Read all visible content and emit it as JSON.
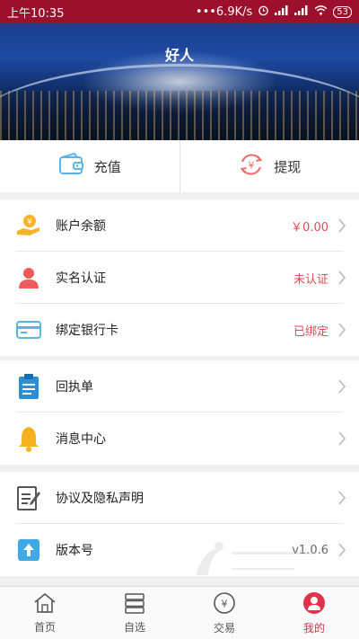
{
  "status_bar": {
    "time": "上午10:35",
    "network_speed": "•••6.9K/s",
    "battery": "53"
  },
  "banner": {
    "title": "好人"
  },
  "quick_actions": [
    {
      "label": "充值",
      "icon": "wallet-icon"
    },
    {
      "label": "提现",
      "icon": "withdraw-icon"
    }
  ],
  "account": {
    "balance_label": "账户余额",
    "balance_value": "￥0.00",
    "realname_label": "实名认证",
    "realname_value": "未认证",
    "bankcard_label": "绑定银行卡",
    "bankcard_value": "已绑定"
  },
  "services": {
    "receipt_label": "回执单",
    "messages_label": "消息中心"
  },
  "about": {
    "agreement_label": "协议及隐私声明",
    "version_label": "版本号",
    "version_value": "v1.0.6"
  },
  "tabs": [
    {
      "label": "首页",
      "icon": "home-icon"
    },
    {
      "label": "自选",
      "icon": "watchlist-icon"
    },
    {
      "label": "交易",
      "icon": "trade-icon"
    },
    {
      "label": "我的",
      "icon": "profile-icon",
      "active": true
    }
  ],
  "colors": {
    "brand": "#9c0f2d",
    "accent": "#d6334a",
    "value_red": "#e24c55"
  }
}
